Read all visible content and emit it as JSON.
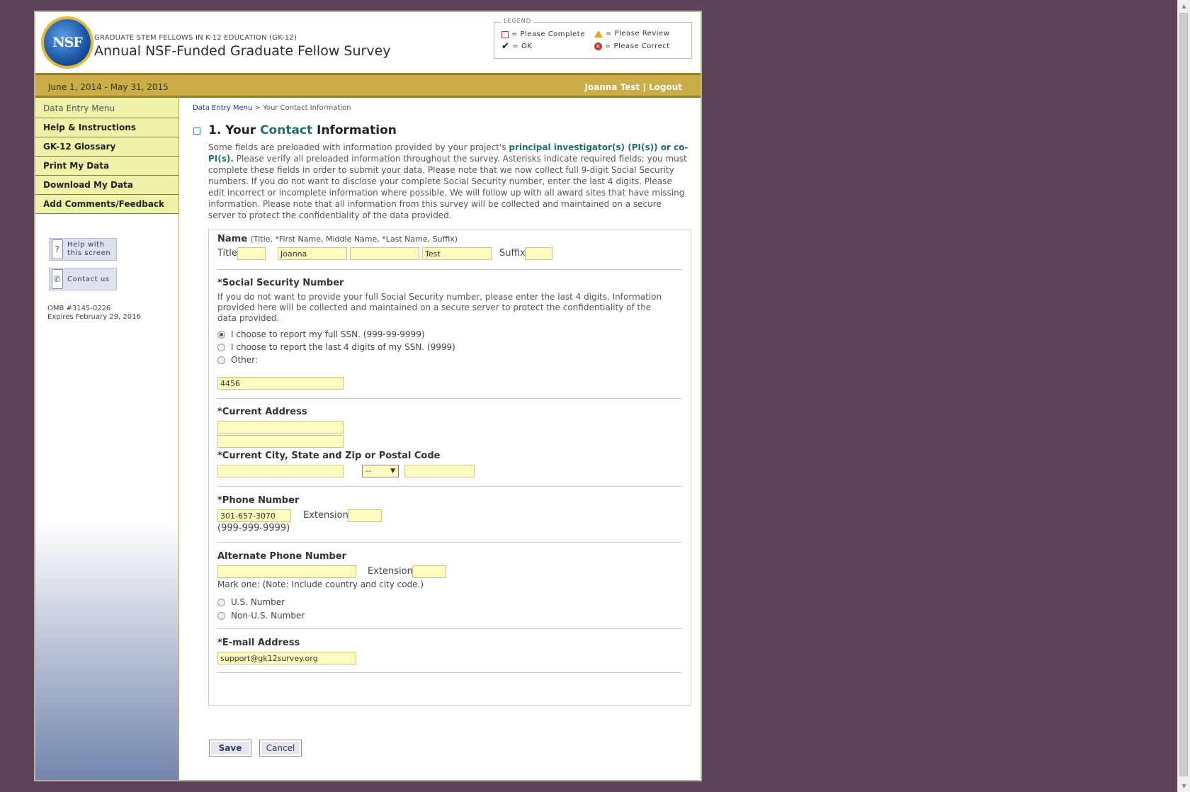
{
  "header": {
    "logo_text": "NSF",
    "program": "GRADUATE STEM FELLOWS IN K-12 EDUCATION (GK-12)",
    "title": "Annual NSF-Funded Graduate Fellow Survey",
    "legend": {
      "title": "LEGEND",
      "please_complete": "= Please Complete",
      "please_review": "= Please Review",
      "ok": "= OK",
      "please_correct": "= Please Correct"
    }
  },
  "bar": {
    "date_range": "June 1, 2014 - May 31, 2015",
    "user": "Joanna Test",
    "separator": "|",
    "logout": "Logout"
  },
  "sidebar": {
    "menu_title": "Data Entry Menu",
    "items": [
      {
        "label": "Help & Instructions"
      },
      {
        "label": "GK-12 Glossary"
      },
      {
        "label": "Print My Data"
      },
      {
        "label": "Download My Data"
      },
      {
        "label": "Add Comments/Feedback"
      }
    ],
    "help_button": "Help with this screen",
    "contact_button": "Contact us",
    "omb_number": "OMB #3145-0226",
    "omb_expires": "Expires February 29, 2016"
  },
  "breadcrumb": {
    "link": "Data Entry Menu",
    "separator": ">",
    "current": "Your Contact Information"
  },
  "section": {
    "number": "1.",
    "title_pre": "Your",
    "title_hl": "Contact",
    "title_post": "Information",
    "intro_a": "Some fields are preloaded with information provided by your project's",
    "intro_link": "principal investigator(s) (PI(s)) or co-PI(s).",
    "intro_b": "Please verify all preloaded information throughout the survey. Asterisks indicate required fields; you must complete these fields in order to submit your data. Please note that we now collect full 9-digit Social Security numbers. If you do not want to disclose your complete Social Security number, enter the last 4 digits. Please edit incorrect or incomplete information where possible. We will follow up with all award sites that have missing information. Please note that all information from this survey will be collected and maintained on a secure server to protect the confidentiality of the data provided."
  },
  "name": {
    "label": "Name",
    "hint": "(Title, *First Name, Middle Name, *Last Name, Suffix)",
    "title_label": "Title",
    "title_value": "",
    "first_value": "Joanna",
    "middle_value": "",
    "last_value": "Test",
    "suffix_label": "Suffix",
    "suffix_value": ""
  },
  "ssn": {
    "label": "*Social Security Number",
    "help": "If you do not want to provide your full Social Security number, please enter the last 4 digits. Information provided here will be collected and maintained on a secure server to protect the confidentiality of the data provided.",
    "options": [
      {
        "label": "I choose to report my full SSN. (999-99-9999)",
        "selected": true
      },
      {
        "label": "I choose to report the last 4 digits of my SSN. (9999)",
        "selected": false
      },
      {
        "label": "Other:",
        "selected": false
      }
    ],
    "value": "4456"
  },
  "address": {
    "label": "*Current Address",
    "line1": "",
    "line2": "",
    "city_label": "*Current City, State and Zip or Postal Code",
    "city": "",
    "state": "--",
    "zip": ""
  },
  "phone": {
    "label": "*Phone Number",
    "value": "301-657-3070",
    "ext_label": "Extension",
    "ext_value": "",
    "format": "(999-999-9999)"
  },
  "alt_phone": {
    "label": "Alternate Phone Number",
    "value": "",
    "ext_label": "Extension",
    "ext_value": "",
    "mark_one": "Mark one: (Note: Include country and city code.)",
    "options": [
      {
        "label": "U.S. Number",
        "selected": false
      },
      {
        "label": "Non-U.S. Number",
        "selected": false
      }
    ]
  },
  "email": {
    "label": "*E-mail Address",
    "value": "support@gk12survey.org"
  },
  "buttons": {
    "save": "Save",
    "cancel": "Cancel"
  },
  "colors": {
    "background": "#5e4359",
    "gold_bar": "#c9ad47",
    "nav_item": "#eef3a9",
    "input_fill": "#fffcc0",
    "accent_teal": "#1f6e74"
  }
}
